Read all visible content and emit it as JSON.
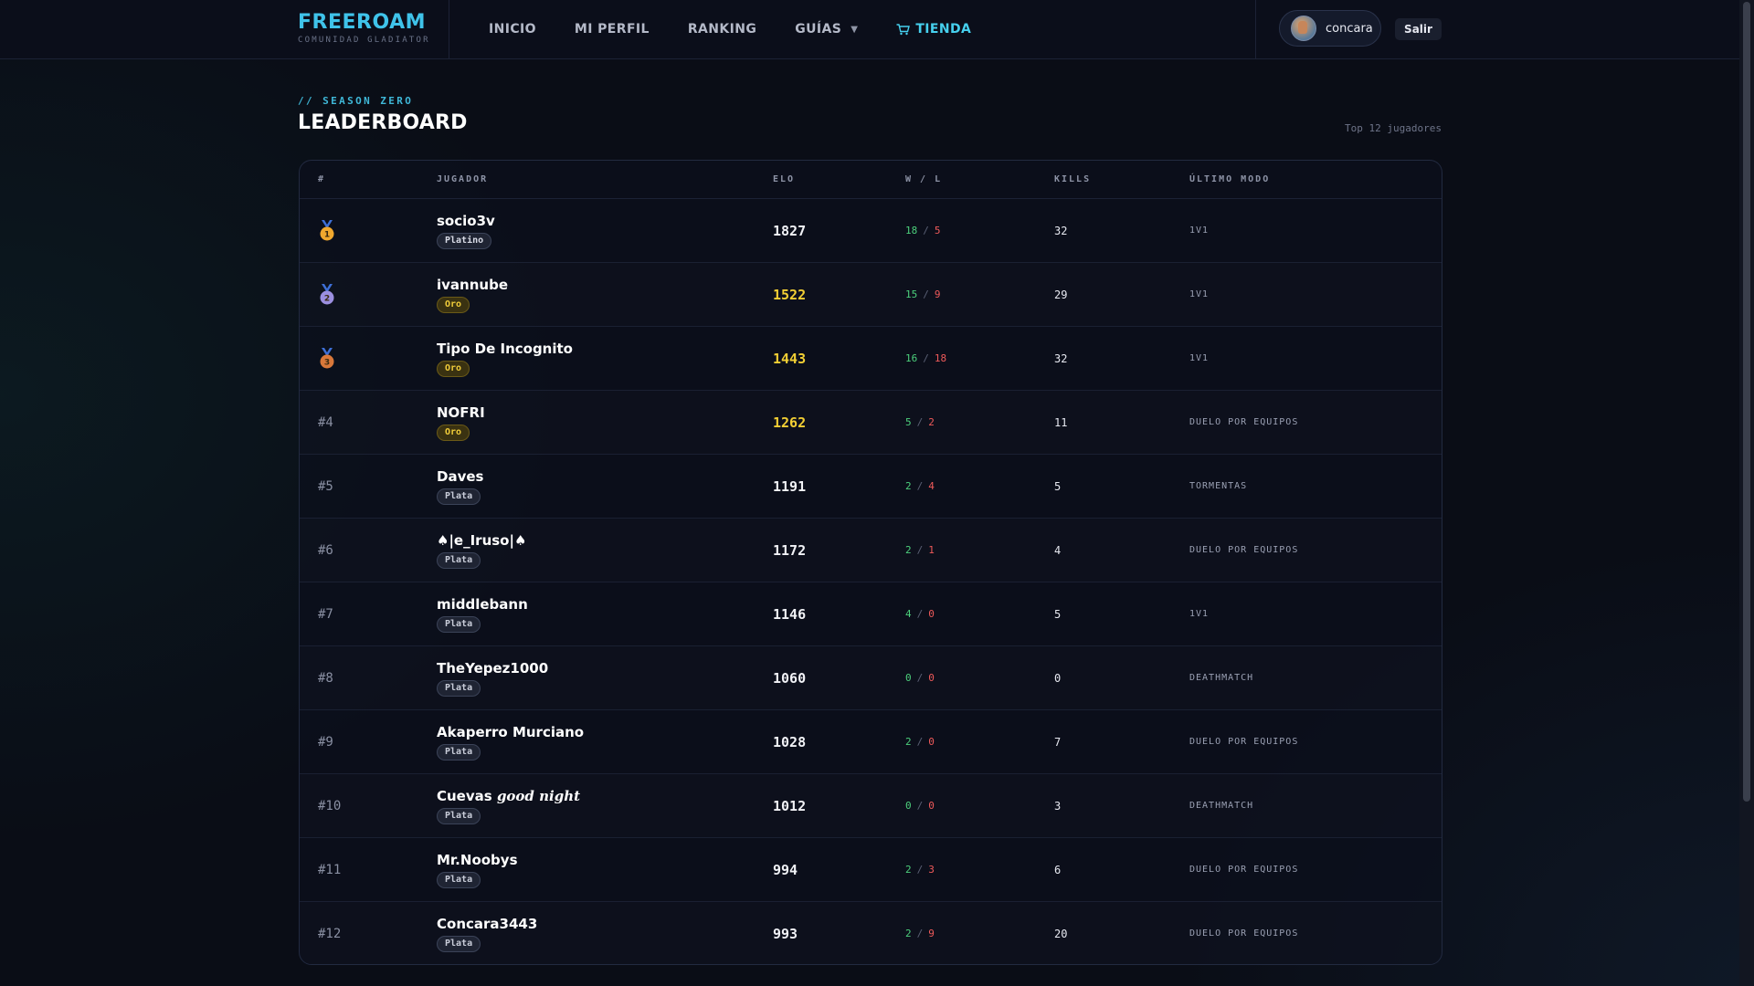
{
  "header": {
    "brand": "FREEROAM",
    "brand_sub": "COMUNIDAD GLADIATOR",
    "nav": [
      {
        "label": "INICIO"
      },
      {
        "label": "MI PERFIL"
      },
      {
        "label": "RANKING"
      },
      {
        "label": "GUÍAS",
        "has_dropdown": true,
        "caret": "▼"
      },
      {
        "label": "TIENDA",
        "icon": "cart-icon",
        "accent": "#46d0ee"
      }
    ],
    "user": {
      "name": "concara"
    },
    "logout_label": "Salir"
  },
  "page": {
    "kicker": "// SEASON ZERO",
    "title": "LEADERBOARD",
    "count_text": "Top 12 jugadores"
  },
  "table": {
    "columns": [
      "#",
      "JUGADOR",
      "ELO",
      "W / L",
      "KILLS",
      "ÚLTIMO MODO"
    ],
    "rows": [
      {
        "rank": "1",
        "rank_display": "medal-gold",
        "name": "socio3v",
        "tier": "Platino",
        "elo": "1827",
        "elo_highlight": false,
        "wins": "18",
        "losses": "5",
        "kills": "32",
        "mode": "1V1"
      },
      {
        "rank": "2",
        "rank_display": "medal-silver",
        "name": "ivannube",
        "tier": "Oro",
        "elo": "1522",
        "elo_highlight": true,
        "wins": "15",
        "losses": "9",
        "kills": "29",
        "mode": "1V1"
      },
      {
        "rank": "3",
        "rank_display": "medal-bronze",
        "name": "Tipo De Incognito",
        "tier": "Oro",
        "elo": "1443",
        "elo_highlight": true,
        "wins": "16",
        "losses": "18",
        "kills": "32",
        "mode": "1V1"
      },
      {
        "rank": "#4",
        "name": "NOFRI",
        "tier": "Oro",
        "elo": "1262",
        "elo_highlight": true,
        "wins": "5",
        "losses": "2",
        "kills": "11",
        "mode": "DUELO POR EQUIPOS"
      },
      {
        "rank": "#5",
        "name": "Daves",
        "tier": "Plata",
        "elo": "1191",
        "elo_highlight": false,
        "wins": "2",
        "losses": "4",
        "kills": "5",
        "mode": "TORMENTAS"
      },
      {
        "rank": "#6",
        "name": "♠|e_Iruso|♠",
        "tier": "Plata",
        "elo": "1172",
        "elo_highlight": false,
        "wins": "2",
        "losses": "1",
        "kills": "4",
        "mode": "DUELO POR EQUIPOS"
      },
      {
        "rank": "#7",
        "name": "middlebann",
        "tier": "Plata",
        "elo": "1146",
        "elo_highlight": false,
        "wins": "4",
        "losses": "0",
        "kills": "5",
        "mode": "1V1"
      },
      {
        "rank": "#8",
        "name": "TheYepez1000",
        "tier": "Plata",
        "elo": "1060",
        "elo_highlight": false,
        "wins": "0",
        "losses": "0",
        "kills": "0",
        "mode": "DEATHMATCH"
      },
      {
        "rank": "#9",
        "name": "Akaperro Murciano",
        "tier": "Plata",
        "elo": "1028",
        "elo_highlight": false,
        "wins": "2",
        "losses": "0",
        "kills": "7",
        "mode": "DUELO POR EQUIPOS"
      },
      {
        "rank": "#10",
        "name": "Cuevas",
        "name_fancy": "good night",
        "tier": "Plata",
        "elo": "1012",
        "elo_highlight": false,
        "wins": "0",
        "losses": "0",
        "kills": "3",
        "mode": "DEATHMATCH"
      },
      {
        "rank": "#11",
        "name": "Mr.Noobys",
        "tier": "Plata",
        "elo": "994",
        "elo_highlight": false,
        "wins": "2",
        "losses": "3",
        "kills": "6",
        "mode": "DUELO POR EQUIPOS"
      },
      {
        "rank": "#12",
        "name": "Concara3443",
        "tier": "Plata",
        "elo": "993",
        "elo_highlight": false,
        "wins": "2",
        "losses": "9",
        "kills": "20",
        "mode": "DUELO POR EQUIPOS"
      }
    ],
    "wl_separator": "/"
  },
  "colors": {
    "brand": "#3fc3ea",
    "gold_elo": "#f2cf34",
    "win": "#4cd07c",
    "loss": "#ef5a5a",
    "medal_gold": "#f0a82e",
    "medal_silver": "#9b8fe0",
    "medal_bronze": "#d9783a"
  }
}
